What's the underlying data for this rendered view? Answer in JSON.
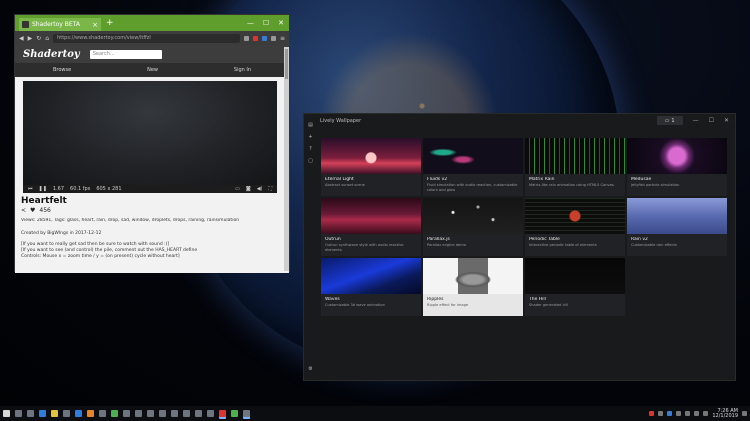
{
  "browser": {
    "tab_title": "Shadertoy BETA",
    "url": "https://www.shadertoy.com/view/ltffzl",
    "site_logo": "Shadertoy",
    "search_placeholder": "Search...",
    "menu": [
      "Browse",
      "New",
      "Sign In"
    ],
    "player": {
      "time": "1.67",
      "fps": "60.1 fps",
      "resolution": "605 x 281"
    },
    "shader_title": "Heartfelt",
    "likes": "456",
    "views_tags": "Views: 28591, Tags: glass, heart, rain, drop, sad, window, droplets, drops, raining, rainsimulation",
    "created": "Created by BigWIngs in 2017-12-12",
    "description": [
      "[If you want to really get sad then be sure to watch with sound :)]",
      "[If you want to see (and control) the pile, comment out the HAS_HEART define",
      "Controls: Mouse x = zoom time / y = (on present) cycle without heart]"
    ]
  },
  "lively": {
    "title": "Lively Wallpaper",
    "monitor_label": "1",
    "wallpapers": [
      {
        "name": "Eternal Light",
        "sub": "Abstract sunset scene"
      },
      {
        "name": "Fluids v2",
        "sub": "Fluid simulation with audio reaction, customizable colors and glow"
      },
      {
        "name": "Matrix Rain",
        "sub": "Matrix-like rain animation using HTML5 Canvas"
      },
      {
        "name": "Medusae",
        "sub": "Jellyfish particle simulation"
      },
      {
        "name": "Outrun",
        "sub": "Outrun synthwave style with audio reactive elements"
      },
      {
        "name": "Parallax.js",
        "sub": "Parallax engine demo"
      },
      {
        "name": "Periodic Table",
        "sub": "Interactive periodic table of elements"
      },
      {
        "name": "Rain v2",
        "sub": "Customizable rain effects"
      },
      {
        "name": "Waves",
        "sub": "Customizable 3d wave animation"
      },
      {
        "name": "Ripples",
        "sub": "Ripple effect for image"
      },
      {
        "name": "The Hill",
        "sub": "Shader generated hill"
      }
    ]
  },
  "taskbar": {
    "time": "7:26 AM",
    "date": "12/1/2019"
  },
  "colors": {
    "tabbar": "#5f9d2c",
    "accent": "#7ab6ff"
  }
}
